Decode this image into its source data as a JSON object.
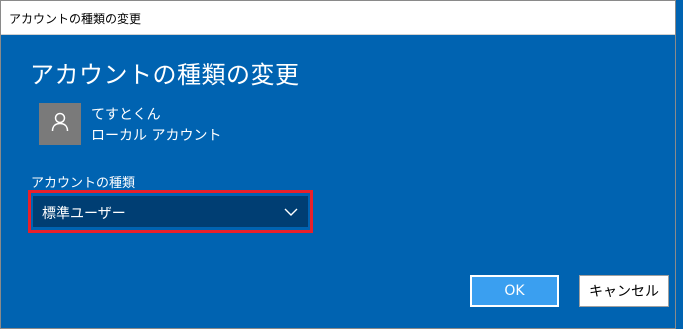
{
  "window": {
    "title": "アカウントの種類の変更"
  },
  "dialog": {
    "heading": "アカウントの種類の変更",
    "user": {
      "name": "てすとくん",
      "type": "ローカル アカウント",
      "avatar_icon": "person-icon"
    },
    "account_type_label": "アカウントの種類",
    "account_type_select": {
      "selected": "標準ユーザー",
      "icon": "chevron-down-icon"
    },
    "buttons": {
      "ok": "OK",
      "cancel": "キャンセル"
    }
  },
  "colors": {
    "dialog_bg": "#0063b1",
    "select_bg": "#003e73",
    "ok_button_bg": "#3a9ff0",
    "highlight_border": "#e8202a"
  }
}
